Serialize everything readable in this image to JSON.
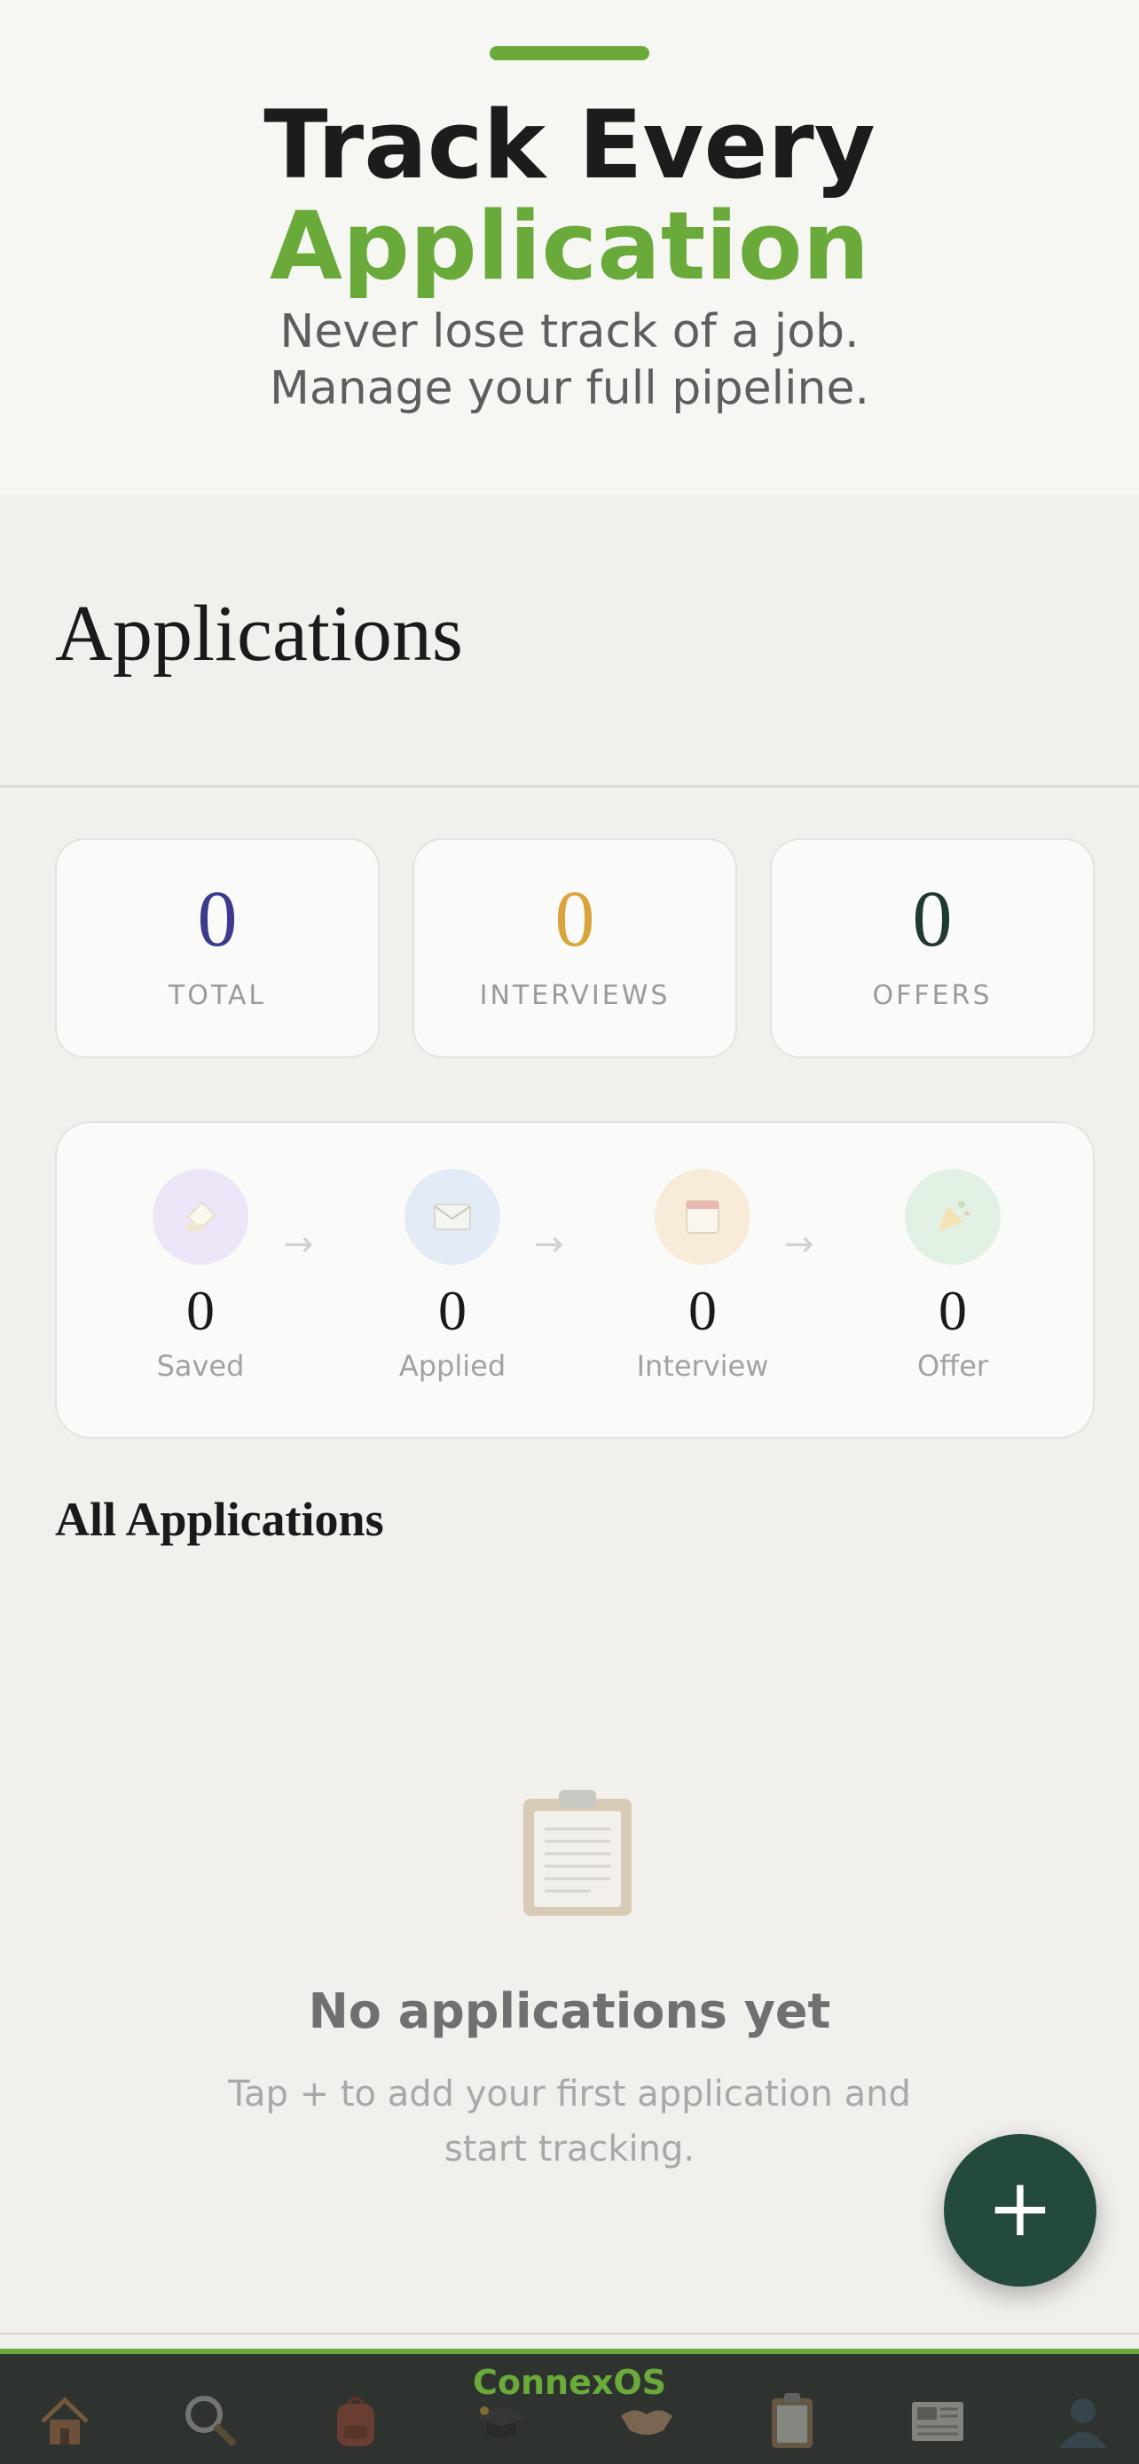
{
  "promo": {
    "title_line1": "Track Every",
    "title_line2": "Application",
    "subtitle_line1": "Never lose track of a job.",
    "subtitle_line2": "Manage your full pipeline."
  },
  "page": {
    "title": "Applications"
  },
  "stats": [
    {
      "value": "0",
      "label": "TOTAL",
      "color": "#3b3a8c"
    },
    {
      "value": "0",
      "label": "INTERVIEWS",
      "color": "#d9a53b"
    },
    {
      "value": "0",
      "label": "OFFERS",
      "color": "#1f3a30"
    }
  ],
  "pipeline": {
    "stages": [
      {
        "value": "0",
        "label": "Saved",
        "icon": "bookmark-icon",
        "color": "#ece6f8"
      },
      {
        "value": "0",
        "label": "Applied",
        "icon": "envelope-icon",
        "color": "#e3ebf7"
      },
      {
        "value": "0",
        "label": "Interview",
        "icon": "calendar-icon",
        "color": "#f8ecd8"
      },
      {
        "value": "0",
        "label": "Offer",
        "icon": "party-popper-icon",
        "color": "#e3f1e4"
      }
    ],
    "arrow": "→"
  },
  "list": {
    "title": "All Applications",
    "empty_title": "No applications yet",
    "empty_line1": "Tap + to add your first application and",
    "empty_line2": "start tracking."
  },
  "fab": {
    "label": "+"
  },
  "tabbar": {
    "brand": "ConnexOS",
    "tabs": [
      "home-icon",
      "search-icon",
      "backpack-icon",
      "graduation-cap-icon",
      "handshake-icon",
      "clipboard-icon",
      "newspaper-icon",
      "profile-icon"
    ]
  }
}
